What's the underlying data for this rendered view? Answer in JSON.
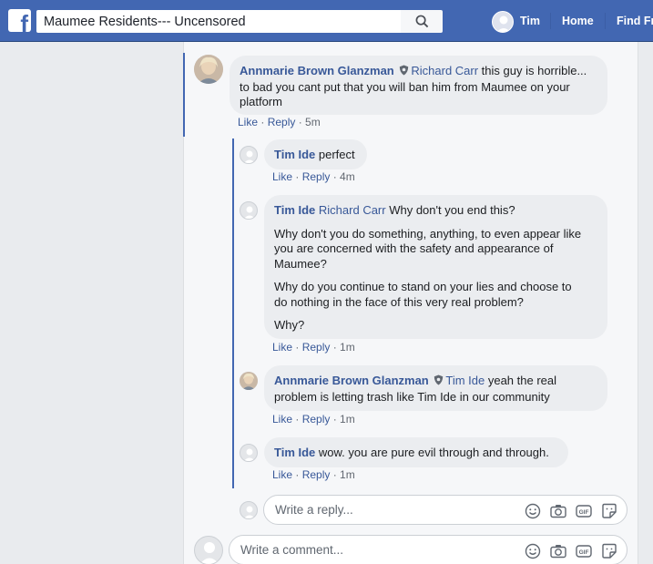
{
  "topbar": {
    "search_value": "Maumee Residents--- Uncensored",
    "user_name": "Tim",
    "home_label": "Home",
    "find_friends_label": "Find Fr"
  },
  "comments": [
    {
      "author": "Annmarie Brown Glanzman",
      "badge": "admin-shield-icon",
      "mention": "Richard Carr",
      "text": " this guy is horrible...",
      "text2": "to bad you cant put that you will ban him from Maumee on your",
      "text3": "platform",
      "like": "Like",
      "reply": "Reply",
      "time": "5m"
    }
  ],
  "replies": [
    {
      "author": "Tim Ide",
      "text": " perfect",
      "like": "Like",
      "reply": "Reply",
      "time": "4m"
    },
    {
      "author": "Tim Ide",
      "mention": "Richard Carr",
      "line1": " Why don't you end this?",
      "para2_l1": "Why don't you do something, anything, to even appear like",
      "para2_l2": "you are concerned with the safety and appearance of",
      "para2_l3": "Maumee?",
      "para3_l1": "Why do you continue to stand on your lies and choose to",
      "para3_l2": "do nothing in the face of this very real problem?",
      "para4": "Why?",
      "like": "Like",
      "reply": "Reply",
      "time": "1m"
    },
    {
      "author": "Annmarie Brown Glanzman",
      "badge": "admin-shield-icon",
      "mention": "Tim Ide",
      "text": " yeah the real",
      "text2": "problem is letting trash like Tim Ide in our community",
      "like": "Like",
      "reply": "Reply",
      "time": "1m"
    },
    {
      "author": "Tim Ide",
      "text": " wow. you are pure evil through and through.",
      "like": "Like",
      "reply": "Reply",
      "time": "1m"
    }
  ],
  "reply_box": {
    "placeholder": "Write a reply..."
  },
  "comment_box": {
    "placeholder": "Write a comment..."
  },
  "meta_separator": " · ",
  "colors": {
    "brand": "#4267b2",
    "link": "#385898",
    "bubble": "#ebedf0"
  }
}
